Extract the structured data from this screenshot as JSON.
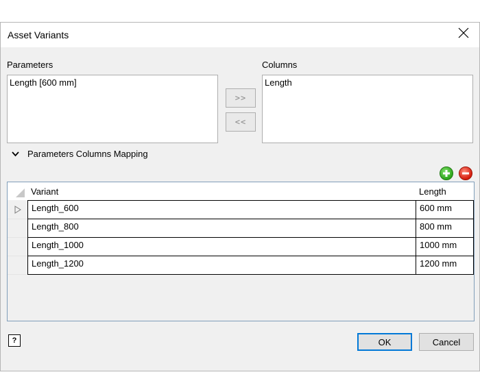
{
  "window": {
    "title": "Asset Variants"
  },
  "parameters": {
    "label": "Parameters",
    "items": [
      "Length [600 mm]"
    ]
  },
  "columns": {
    "label": "Columns",
    "items": [
      "Length"
    ]
  },
  "transfer": {
    "add_label": ">>",
    "remove_label": "<<"
  },
  "mapping": {
    "label": "Parameters Columns Mapping",
    "expanded": true
  },
  "grid": {
    "headers": [
      "Variant",
      "Length"
    ],
    "rows": [
      {
        "variant": "Length_600",
        "length": "600 mm"
      },
      {
        "variant": "Length_800",
        "length": "800 mm"
      },
      {
        "variant": "Length_1000",
        "length": "1000 mm"
      },
      {
        "variant": "Length_1200",
        "length": "1200 mm"
      }
    ]
  },
  "footer": {
    "help_label": "?",
    "ok_label": "OK",
    "cancel_label": "Cancel"
  },
  "colors": {
    "accent": "#0078d7",
    "add": "#2ea51c",
    "remove": "#d41b0b"
  }
}
